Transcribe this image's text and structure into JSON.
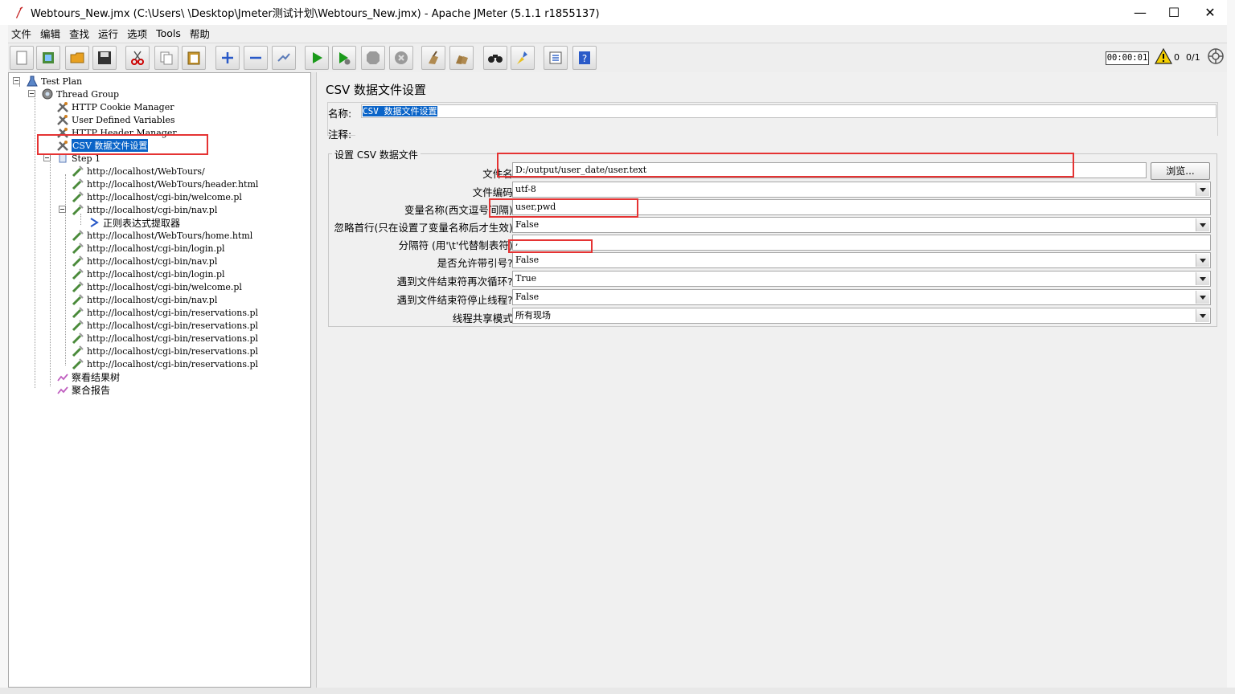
{
  "window": {
    "title": "Webtours_New.jmx (C:\\Users\\        \\Desktop\\Jmeter测试计划\\Webtours_New.jmx) - Apache JMeter (5.1.1 r1855137)",
    "minimize": "—",
    "maximize": "☐",
    "close": "✕"
  },
  "menu": [
    "文件",
    "编辑",
    "查找",
    "运行",
    "选项",
    "Tools",
    "帮助"
  ],
  "toolbar_icons": [
    "new-icon",
    "templates-icon",
    "open-icon",
    "save-icon",
    "cut-icon",
    "copy-icon",
    "paste-icon",
    "expand-icon",
    "collapse-icon",
    "toggle-icon",
    "start-icon",
    "start-no-timers-icon",
    "stop-icon",
    "shutdown-icon",
    "clear-icon",
    "clear-all-icon",
    "search-icon",
    "reset-search-icon",
    "function-helper-icon",
    "help-icon"
  ],
  "status": {
    "timer": "00:00:01",
    "warnings": "0",
    "threads": "0/1"
  },
  "tree": {
    "test_plan": "Test Plan",
    "thread_group": "Thread Group",
    "cookie_manager": "HTTP Cookie Manager",
    "user_vars": "User Defined Variables",
    "header_manager": "HTTP Header Manager",
    "csv_config": "CSV 数据文件设置",
    "step1": "Step 1",
    "samplers": [
      "http://localhost/WebTours/",
      "http://localhost/WebTours/header.html",
      "http://localhost/cgi-bin/welcome.pl",
      "http://localhost/cgi-bin/nav.pl",
      "正则表达式提取器",
      "http://localhost/WebTours/home.html",
      "http://localhost/cgi-bin/login.pl",
      "http://localhost/cgi-bin/nav.pl",
      "http://localhost/cgi-bin/login.pl",
      "http://localhost/cgi-bin/welcome.pl",
      "http://localhost/cgi-bin/nav.pl",
      "http://localhost/cgi-bin/reservations.pl",
      "http://localhost/cgi-bin/reservations.pl",
      "http://localhost/cgi-bin/reservations.pl",
      "http://localhost/cgi-bin/reservations.pl",
      "http://localhost/cgi-bin/reservations.pl"
    ],
    "results_tree": "察看结果树",
    "aggregate": "聚合报告"
  },
  "form": {
    "title": "CSV 数据文件设置",
    "name_label": "名称:",
    "name_value": "CSV 数据文件设置",
    "comment_label": "注释:",
    "group_title": "设置 CSV 数据文件",
    "filename_label": "文件名:",
    "filename_value": "D:/output/user_date/user.text",
    "browse": "浏览...",
    "encoding_label": "文件编码:",
    "encoding_value": "utf-8",
    "varnames_label": "变量名称(西文逗号间隔):",
    "varnames_value": "user,pwd",
    "ignore_first_label": "忽略首行(只在设置了变量名称后才生效):",
    "ignore_first_value": "False",
    "delimiter_label": "分隔符 (用'\\t'代替制表符):",
    "delimiter_value": ",",
    "quoted_label": "是否允许带引号?:",
    "quoted_value": "False",
    "recycle_label": "遇到文件结束符再次循环?:",
    "recycle_value": "True",
    "stop_thread_label": "遇到文件结束符停止线程?:",
    "stop_thread_value": "False",
    "sharing_label": "线程共享模式:",
    "sharing_value": "所有现场"
  }
}
